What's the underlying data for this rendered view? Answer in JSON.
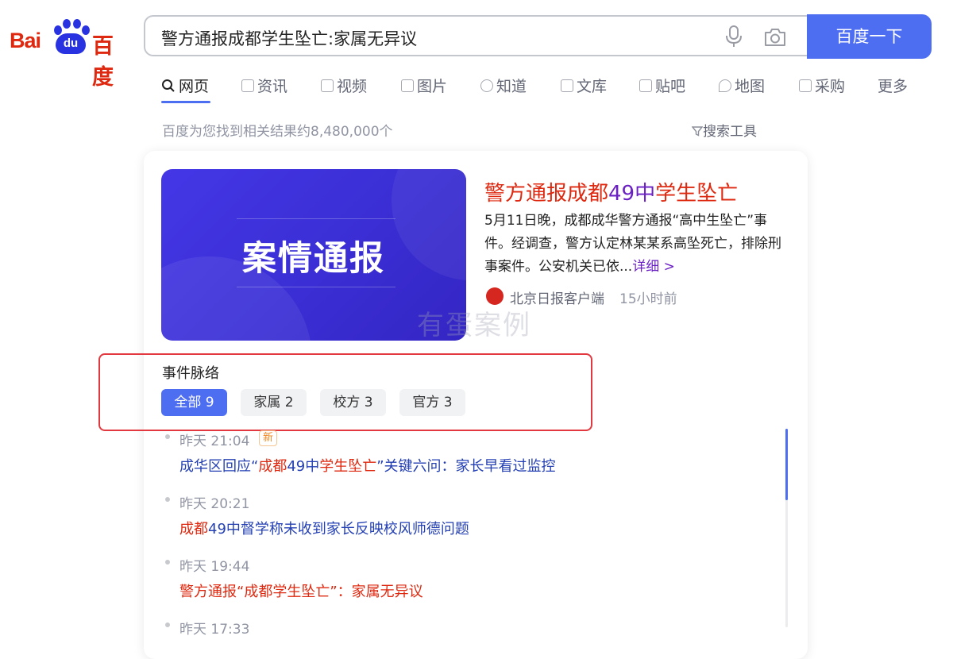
{
  "logo": {
    "text_bai": "Bai",
    "text_du": "du",
    "text_cn": "百度"
  },
  "search": {
    "query": "警方通报成都学生坠亡:家属无异议",
    "button_label": "百度一下"
  },
  "tabs": [
    {
      "label": "网页",
      "icon": "search-icon"
    },
    {
      "label": "资讯",
      "icon": "news-icon"
    },
    {
      "label": "视频",
      "icon": "video-icon"
    },
    {
      "label": "图片",
      "icon": "image-icon"
    },
    {
      "label": "知道",
      "icon": "question-icon"
    },
    {
      "label": "文库",
      "icon": "doc-icon"
    },
    {
      "label": "贴吧",
      "icon": "tieba-icon"
    },
    {
      "label": "地图",
      "icon": "map-icon"
    },
    {
      "label": "采购",
      "icon": "shop-icon"
    },
    {
      "label": "更多"
    }
  ],
  "result_count": "百度为您找到相关结果约8,480,000个",
  "search_tools": "搜索工具",
  "news": {
    "thumb_text": "案情通报",
    "title_a": "警方通报成都",
    "title_b": "49中",
    "title_c": "学生坠亡",
    "summary": "5月11日晚，成都成华警方通报“高中生坠亡”事件。经调查，警方认定林某某系高坠死亡，排除刑事案件。公安机关已依...",
    "detail_link": "详细 >",
    "source": "北京日报客户端",
    "time": "15小时前"
  },
  "watermark": "有蛋案例",
  "timeline": {
    "heading": "事件脉络",
    "filters": [
      {
        "label": "全部 9",
        "active": true
      },
      {
        "label": "家属 2"
      },
      {
        "label": "校方 3"
      },
      {
        "label": "官方 3"
      }
    ],
    "new_badge": "新",
    "items": [
      {
        "time": "昨天 21:04",
        "parts": [
          "成华区回应“",
          "成都",
          "49中",
          "学生坠亡",
          "”关键六问：家长早看过监控"
        ]
      },
      {
        "time": "昨天 20:21",
        "parts": [
          "成都",
          "49中督学称未收到家长反映校风师德问题"
        ]
      },
      {
        "time": "昨天 19:44",
        "parts": [
          "警方通报“成都学生坠亡”：家属无异议"
        ]
      },
      {
        "time": "昨天 17:33"
      }
    ]
  },
  "colors": {
    "accent": "#4e6ef2",
    "brand_red": "#de2910",
    "link_blue": "#2440b3",
    "visited_purple": "#6b20c4"
  }
}
